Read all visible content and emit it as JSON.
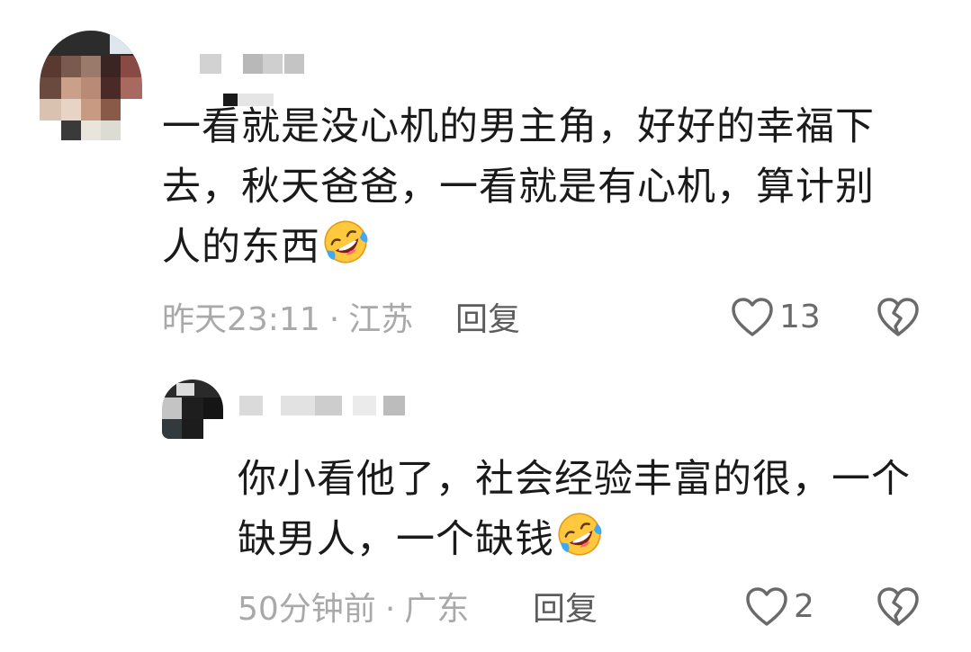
{
  "comments": [
    {
      "text_lines": [
        "一看就是没心机的男主角，好好的幸福下",
        "去，秋天爸爸，一看就是有心机，算计别",
        "人的东西"
      ],
      "emoji": "rolling-on-floor-laughing-emoji",
      "time": "昨天23:11",
      "separator": "·",
      "location": "江苏",
      "reply_label": "回复",
      "like_count": "13"
    },
    {
      "text_lines": [
        "你小看他了，社会经验丰富的很，一个",
        "缺男人，一个缺钱"
      ],
      "emoji": "rolling-on-floor-laughing-emoji",
      "time": "50分钟前",
      "separator": "·",
      "location": "广东",
      "reply_label": "回复",
      "like_count": "2"
    }
  ],
  "icons": {
    "like": "heart-outline-icon",
    "dislike": "broken-heart-icon"
  },
  "colors": {
    "text": "#1a1a1a",
    "meta": "#a9a9a9",
    "reply": "#5c5c5c",
    "icon": "#6a6a6a",
    "emoji_face": "#ffc83d",
    "emoji_tears": "#3fa9f5"
  }
}
